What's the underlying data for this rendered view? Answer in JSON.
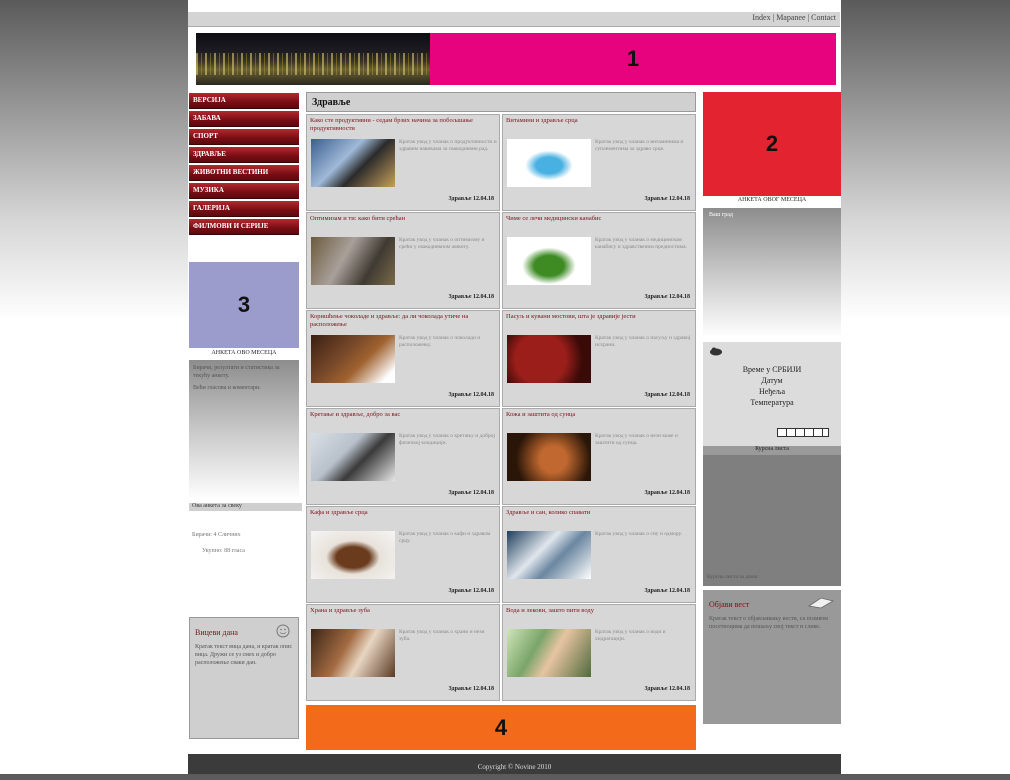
{
  "toplinks": "Index | Mapanee | Contact",
  "zones": {
    "z1": "1",
    "z2": "2",
    "z3": "3",
    "z4": "4"
  },
  "menu": [
    "ВЕРСИЈА",
    "ЗАБАВА",
    "СПОРТ",
    "ЗДРАВЉЕ",
    "ЖИВОТНИ ВЕСТИНИ",
    "МУЗИКА",
    "ГАЛЕРИЈА",
    "ФИЛМОВИ И СЕРИЈЕ"
  ],
  "left": {
    "head": "АНКЕТА ОВО МЕСЕЦА",
    "p1": "Бирачи, резултати и статистика за текућу анкету.",
    "p2": "Већи гласова и коментари.",
    "bar2": "Ова анкета за свеку",
    "small1": "Бирачи: 4 Сличних",
    "small2": "Укупно:  88  гласа",
    "box_title": "Вицеви дана",
    "box_text": "Кратак текст вица дана, и кратак опис вица. Дружи се уз смех и добро расположење сваки дан."
  },
  "main": {
    "heading": "Здравље",
    "articles": [
      {
        "title": "Како сте продуктивни - седам брзих начина за побољшање продуктивности",
        "text": "Кратак увод у чланак о продуктивности и здравим навикама за свакодневни рад.",
        "date": "Здравље  12.04.18"
      },
      {
        "title": "Витамини и здравље срца",
        "text": "Кратак увод у чланак о витаминима и суплементима за здраво срце.",
        "date": "Здравље  12.04.18"
      },
      {
        "title": "Оптимизам и ти: како бити срећан",
        "text": "Кратак увод у чланак о оптимизму и срећи у свакодневном животу.",
        "date": "Здравље  12.04.18"
      },
      {
        "title": "Чиме се лечи медицински канабис",
        "text": "Кратак увод у чланак о медицинском канабису и здравственим предностима.",
        "date": "Здравље  12.04.18"
      },
      {
        "title": "Коришћење чоколаде и здравље: да ли чоколада утиче на расположење",
        "text": "Кратак увод у чланак о чоколади и расположењу.",
        "date": "Здравље  12.04.18"
      },
      {
        "title": "Пасуљ и кувани мостови, шта је здравије јести",
        "text": "Кратак увод у чланак о пасуљу и здравој исхрани.",
        "date": "Здравље  12.04.18"
      },
      {
        "title": "Кретање и здравље, добро за вас",
        "text": "Кратак увод у чланак о кретању и доброј физичкој кондицији.",
        "date": "Здравље  12.04.18"
      },
      {
        "title": "Кожа и заштита од сунца",
        "text": "Кратак увод у чланак о нези коже и заштити од сунца.",
        "date": "Здравље  12.04.18"
      },
      {
        "title": "Кафа и здравље срца",
        "text": "Кратак увод у чланак о кафи и здравом срцу.",
        "date": "Здравље  12.04.18"
      },
      {
        "title": "Здравље и сан, колико спавати",
        "text": "Кратак увод у чланак о сну и одмору.",
        "date": "Здравље  12.04.18"
      },
      {
        "title": "Храна и здравље зуба",
        "text": "Кратак увод у чланак о храни и нези зуба.",
        "date": "Здравље  12.04.18"
      },
      {
        "title": "Вода и лекови, зашто пити воду",
        "text": "Кратак увод у чланак о води и хидратацији.",
        "date": "Здравље  12.04.18"
      }
    ]
  },
  "right": {
    "head": "АНКЕТА ОВОГ МЕСЕЦА",
    "grad": "Ваш град",
    "box_text": "Време у СРБИЈИ\nДатум\nНеђеља\nТемпература",
    "gray_head": "Курсна листа",
    "gray_footer": "Курсна листа за данас",
    "box2_title": "Објави вест",
    "box2_text": "Кратак текст о објављивању вести, са позивом посетиоцима да пошаљу свој текст и слике."
  },
  "footer": "Copyright © Novine 2010",
  "colors": {
    "z1": "#e6037d",
    "z2": "#e42330",
    "z3": "#9c9ccc",
    "z4": "#f26a1a",
    "menu": "#7a0d14"
  }
}
